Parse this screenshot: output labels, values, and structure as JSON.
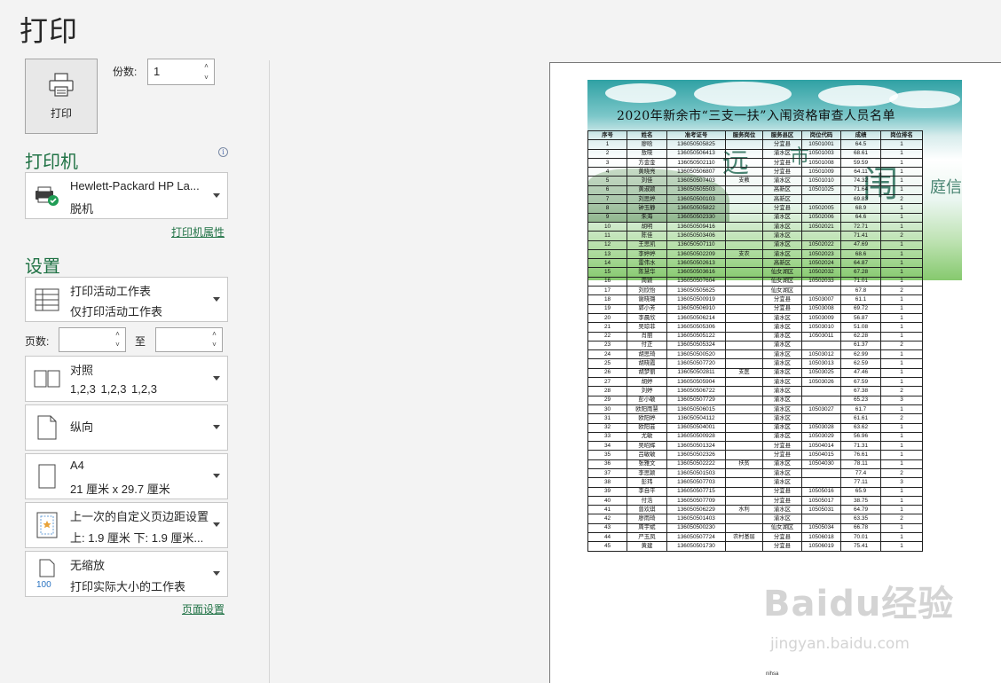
{
  "page_title": "打印",
  "print_button": {
    "label": "打印"
  },
  "copies": {
    "label": "份数:",
    "value": "1"
  },
  "printer": {
    "section_title": "打印机",
    "name": "Hewlett-Packard HP La...",
    "status": "脱机",
    "properties_link": "打印机属性"
  },
  "settings": {
    "section_title": "设置",
    "scope": {
      "line1": "打印活动工作表",
      "line2": "仅打印活动工作表"
    },
    "pages_label": "页数:",
    "to_label": "至",
    "collate": {
      "line1": "对照",
      "line2": "1,2,3    1,2,3    1,2,3"
    },
    "orientation": {
      "line1": "纵向"
    },
    "paper_size": {
      "line1": "A4",
      "line2": "21 厘米 x 29.7 厘米"
    },
    "margins": {
      "line1": "上一次的自定义页边距设置",
      "line2": "上: 1.9 厘米 下: 1.9 厘米..."
    },
    "scaling": {
      "line1": "无缩放",
      "line2": "打印实际大小的工作表",
      "icon_text": "100"
    },
    "page_setup_link": "页面设置"
  },
  "preview": {
    "doc_title": "2020年新余市“三支一扶”入闱资格审查人员名单",
    "watermark_left": "远",
    "watermark_mid": "市",
    "watermark_right": "闱",
    "watermark_tail": "庭信",
    "footer_text": "nihsa",
    "headers": [
      "序号",
      "姓名",
      "准考证号",
      "服务岗位",
      "服务县区",
      "岗位代码",
      "成绩",
      "岗位排名"
    ],
    "rows": [
      [
        "1",
        "廖晗",
        "136050505825",
        "",
        "分宜县",
        "10501001",
        "64.5",
        "1"
      ],
      [
        "2",
        "敖晓",
        "136050506413",
        "",
        "渝水区",
        "10501003",
        "68.61",
        "1"
      ],
      [
        "3",
        "方金金",
        "136050502110",
        "",
        "分宜县",
        "10501008",
        "59.59",
        "1"
      ],
      [
        "4",
        "黄晓亮",
        "136050506807",
        "",
        "分宜县",
        "10501009",
        "64.11",
        "1"
      ],
      [
        "5",
        "刘佳",
        "136050507403",
        "",
        "渝水区",
        "10501010",
        "74.32",
        "1"
      ],
      [
        "6",
        "黄淑颖",
        "136050505503",
        "",
        "高新区",
        "10501025",
        "71.64",
        "1"
      ],
      [
        "7",
        "刘思婷",
        "136050500103",
        "",
        "高新区",
        "",
        "69.83",
        "2"
      ],
      [
        "8",
        "钟玉静",
        "136050505822",
        "",
        "分宜县",
        "10502005",
        "68.9",
        "1"
      ],
      [
        "9",
        "朱海",
        "136050502330",
        "",
        "渝水区",
        "10502006",
        "64.6",
        "1"
      ],
      [
        "10",
        "胡明",
        "136050509416",
        "",
        "渝水区",
        "10502021",
        "72.71",
        "1"
      ],
      [
        "11",
        "陈佳",
        "136050503406",
        "",
        "渝水区",
        "",
        "71.41",
        "2"
      ],
      [
        "12",
        "王思凯",
        "136050507110",
        "",
        "渝水区",
        "10502022",
        "47.69",
        "1"
      ],
      [
        "13",
        "李婷婷",
        "136050502209",
        "",
        "渝水区",
        "10502023",
        "68.6",
        "1"
      ],
      [
        "14",
        "雷伟水",
        "136050502613",
        "",
        "高新区",
        "10502024",
        "64.87",
        "1"
      ],
      [
        "15",
        "陈慧华",
        "136050503616",
        "",
        "仙女湖区",
        "10502032",
        "67.28",
        "1"
      ],
      [
        "16",
        "周颖",
        "136050507604",
        "",
        "仙女湖区",
        "10502033",
        "71.01",
        "1"
      ],
      [
        "17",
        "刘欣怡",
        "136050505625",
        "",
        "仙女湖区",
        "",
        "67.8",
        "2"
      ],
      [
        "18",
        "谢晓璐",
        "136050500919",
        "",
        "分宜县",
        "10503007",
        "61.1",
        "1"
      ],
      [
        "19",
        "郭小芳",
        "136050506910",
        "",
        "分宜县",
        "10503008",
        "69.72",
        "1"
      ],
      [
        "20",
        "李晨欣",
        "136050506214",
        "",
        "渝水区",
        "10503009",
        "56.87",
        "1"
      ],
      [
        "21",
        "吴琼菲",
        "136050505306",
        "",
        "渝水区",
        "10503010",
        "51.08",
        "1"
      ],
      [
        "22",
        "肖丽",
        "136050505122",
        "",
        "渝水区",
        "10503011",
        "62.28",
        "1"
      ],
      [
        "23",
        "付正",
        "136050505324",
        "",
        "渝水区",
        "",
        "61.37",
        "2"
      ],
      [
        "24",
        "胡思琦",
        "136050500520",
        "",
        "渝水区",
        "10503012",
        "62.99",
        "1"
      ],
      [
        "25",
        "胡晓霞",
        "136050507720",
        "",
        "渝水区",
        "10503013",
        "62.59",
        "1"
      ],
      [
        "26",
        "胡梦丽",
        "136050502811",
        "",
        "渝水区",
        "10503025",
        "47.46",
        "1"
      ],
      [
        "27",
        "胡婷",
        "136050505904",
        "",
        "渝水区",
        "10503026",
        "67.59",
        "1"
      ],
      [
        "28",
        "刘婷",
        "136050506722",
        "",
        "渝水区",
        "",
        "67.38",
        "2"
      ],
      [
        "29",
        "彭小敏",
        "136050507729",
        "",
        "渝水区",
        "",
        "65.23",
        "3"
      ],
      [
        "30",
        "欧阳雨慧",
        "136050506015",
        "",
        "渝水区",
        "10503027",
        "61.7",
        "1"
      ],
      [
        "31",
        "欧阳婷",
        "136050504112",
        "",
        "渝水区",
        "",
        "61.61",
        "2"
      ],
      [
        "32",
        "欧阳芸",
        "136050504001",
        "",
        "渝水区",
        "10503028",
        "63.62",
        "1"
      ],
      [
        "33",
        "尤敏",
        "136050500928",
        "",
        "渝水区",
        "10503029",
        "56.96",
        "1"
      ],
      [
        "34",
        "吴昭辉",
        "136050501324",
        "",
        "分宜县",
        "10504014",
        "71.31",
        "1"
      ],
      [
        "35",
        "吕敏敏",
        "136050502326",
        "",
        "分宜县",
        "10504015",
        "76.61",
        "1"
      ],
      [
        "36",
        "张雅文",
        "136050502222",
        "",
        "渝水区",
        "10504030",
        "78.11",
        "1"
      ],
      [
        "37",
        "李思颖",
        "136050501503",
        "",
        "渝水区",
        "",
        "77.4",
        "2"
      ],
      [
        "38",
        "彭玮",
        "136050507703",
        "",
        "渝水区",
        "",
        "77.11",
        "3"
      ],
      [
        "39",
        "李自平",
        "136050507715",
        "",
        "分宜县",
        "10505016",
        "65.9",
        "1"
      ],
      [
        "40",
        "付浩",
        "136050507709",
        "",
        "分宜县",
        "10505017",
        "38.75",
        "1"
      ],
      [
        "41",
        "曾欢琪",
        "136050506229",
        "",
        "渝水区",
        "10505031",
        "64.79",
        "1"
      ],
      [
        "42",
        "廖雨琦",
        "136050501403",
        "",
        "渝水区",
        "",
        "63.35",
        "2"
      ],
      [
        "43",
        "周宇斌",
        "136050500230",
        "",
        "仙女湖区",
        "10505034",
        "66.78",
        "1"
      ],
      [
        "44",
        "严玉凤",
        "136050507724",
        "",
        "分宜县",
        "10506018",
        "70.01",
        "1"
      ],
      [
        "45",
        "黄建",
        "136050501730",
        "",
        "分宜县",
        "10506019",
        "75.41",
        "1"
      ]
    ],
    "group_labels": [
      {
        "row": 4,
        "text": "支教"
      },
      {
        "row": 12,
        "text": "支农"
      },
      {
        "row": 25,
        "text": "支医"
      },
      {
        "row": 35,
        "text": "扶贫"
      },
      {
        "row": 40,
        "text": "水利"
      },
      {
        "row": 43,
        "text": "农村基层"
      }
    ]
  },
  "watermark": {
    "brand": "Baidu经验",
    "url": "jingyan.baidu.com"
  },
  "colors": {
    "accent": "#217346",
    "background": "#f3f3f3"
  }
}
